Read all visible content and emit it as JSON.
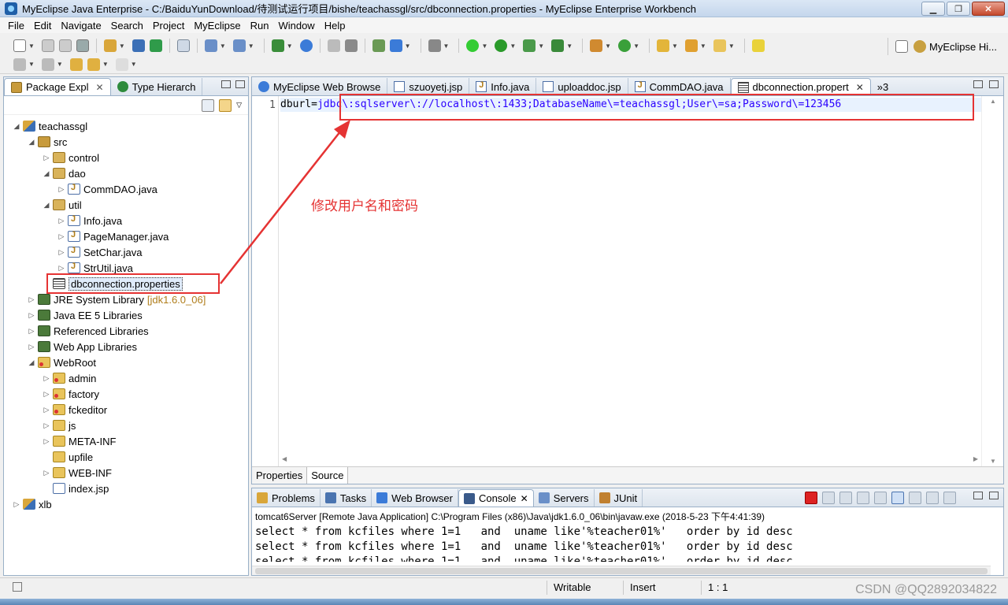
{
  "window": {
    "title": "MyEclipse Java Enterprise - C:/BaiduYunDownload/待测试运行项目/bishe/teachassgl/src/dbconnection.properties - MyEclipse Enterprise Workbench",
    "minimize": "▁",
    "maximize": "❐",
    "close": "✕"
  },
  "menu": [
    "File",
    "Edit",
    "Navigate",
    "Search",
    "Project",
    "MyEclipse",
    "Run",
    "Window",
    "Help"
  ],
  "perspective": {
    "label": "MyEclipse Hi..."
  },
  "left_panel": {
    "tabs": [
      {
        "label": "Package Expl",
        "close": "✕"
      },
      {
        "label": "Type Hierarch"
      }
    ],
    "tree": [
      {
        "label": "teachassgl",
        "icon": "project-icon",
        "twisty": "◢",
        "indent": 0
      },
      {
        "label": "src",
        "icon": "source-folder-icon",
        "twisty": "◢",
        "indent": 1
      },
      {
        "label": "control",
        "icon": "package-icon",
        "twisty": "▷",
        "indent": 2
      },
      {
        "label": "dao",
        "icon": "package-icon",
        "twisty": "◢",
        "indent": 2
      },
      {
        "label": "CommDAO.java",
        "icon": "java-file-icon",
        "twisty": "▷",
        "indent": 3
      },
      {
        "label": "util",
        "icon": "package-icon",
        "twisty": "◢",
        "indent": 2
      },
      {
        "label": "Info.java",
        "icon": "java-file-icon",
        "twisty": "▷",
        "indent": 3
      },
      {
        "label": "PageManager.java",
        "icon": "java-file-icon",
        "twisty": "▷",
        "indent": 3
      },
      {
        "label": "SetChar.java",
        "icon": "java-file-icon",
        "twisty": "▷",
        "indent": 3
      },
      {
        "label": "StrUtil.java",
        "icon": "java-file-icon",
        "twisty": "▷",
        "indent": 3
      },
      {
        "label": "dbconnection.properties",
        "icon": "properties-file-icon",
        "twisty": "",
        "indent": 2,
        "selected": true
      },
      {
        "label": "JRE System Library",
        "extra": "[jdk1.6.0_06]",
        "icon": "library-icon",
        "twisty": "▷",
        "indent": 1
      },
      {
        "label": "Java EE 5 Libraries",
        "icon": "library-icon",
        "twisty": "▷",
        "indent": 1
      },
      {
        "label": "Referenced Libraries",
        "icon": "library-icon",
        "twisty": "▷",
        "indent": 1
      },
      {
        "label": "Web App Libraries",
        "icon": "library-icon",
        "twisty": "▷",
        "indent": 1
      },
      {
        "label": "WebRoot",
        "icon": "web-folder-icon",
        "twisty": "◢",
        "indent": 1
      },
      {
        "label": "admin",
        "icon": "web-folder-icon",
        "twisty": "▷",
        "indent": 2
      },
      {
        "label": "factory",
        "icon": "web-folder-icon",
        "twisty": "▷",
        "indent": 2
      },
      {
        "label": "fckeditor",
        "icon": "web-folder-icon",
        "twisty": "▷",
        "indent": 2
      },
      {
        "label": "js",
        "icon": "folder-icon",
        "twisty": "▷",
        "indent": 2
      },
      {
        "label": "META-INF",
        "icon": "folder-icon",
        "twisty": "▷",
        "indent": 2
      },
      {
        "label": "upfile",
        "icon": "folder-icon",
        "twisty": "",
        "indent": 2
      },
      {
        "label": "WEB-INF",
        "icon": "folder-icon",
        "twisty": "▷",
        "indent": 2
      },
      {
        "label": "index.jsp",
        "icon": "jsp-file-icon",
        "twisty": "",
        "indent": 2
      },
      {
        "label": "xlb",
        "icon": "project-icon",
        "twisty": "▷",
        "indent": 0
      }
    ]
  },
  "editor": {
    "tabs": [
      {
        "label": "MyEclipse Web Browse",
        "icon": "globe-icon"
      },
      {
        "label": "szuoyetj.jsp",
        "icon": "jsp-file-icon"
      },
      {
        "label": "Info.java",
        "icon": "java-file-icon"
      },
      {
        "label": "uploaddoc.jsp",
        "icon": "jsp-file-icon"
      },
      {
        "label": "CommDAO.java",
        "icon": "java-file-icon"
      },
      {
        "label": "dbconnection.propert",
        "icon": "properties-file-icon",
        "active": true,
        "close": "✕"
      }
    ],
    "overflow": "»3",
    "line_number": "1",
    "code_key": "dburl",
    "code_eq": "=",
    "code_value": "jdbc\\:sqlserver\\://localhost\\:1433;DatabaseName\\=teachassgl;User\\=sa;Password\\=123456",
    "bottom_tabs": [
      "Properties",
      "Source"
    ]
  },
  "console": {
    "tabs": [
      {
        "label": "Problems"
      },
      {
        "label": "Tasks"
      },
      {
        "label": "Web Browser"
      },
      {
        "label": "Console",
        "active": true,
        "close": "✕"
      },
      {
        "label": "Servers"
      },
      {
        "label": "JUnit"
      }
    ],
    "process_label": "tomcat6Server [Remote Java Application] C:\\Program Files (x86)\\Java\\jdk1.6.0_06\\bin\\javaw.exe (2018-5-23 下午4:41:39)",
    "lines": [
      "select * from kcfiles where 1=1   and  uname like'%teacher01%'   order by id desc",
      "select * from kcfiles where 1=1   and  uname like'%teacher01%'   order by id desc",
      "select * from kcfiles where 1=1   and  uname like'%teacher01%'   order by id desc"
    ]
  },
  "status": {
    "writable": "Writable",
    "insert": "Insert",
    "position": "1 : 1"
  },
  "annotation": {
    "text": "修改用户名和密码",
    "color": "#e53333"
  },
  "watermark": "CSDN @QQ2892034822"
}
